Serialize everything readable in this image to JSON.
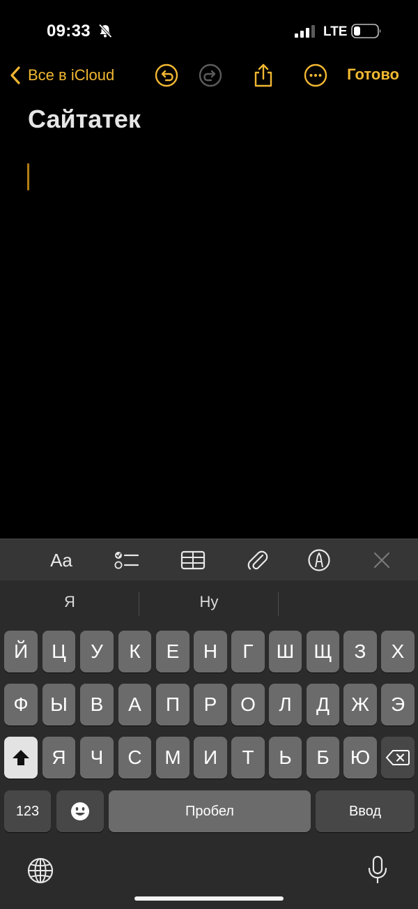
{
  "status_bar": {
    "time": "09:33",
    "network": "LTE"
  },
  "nav": {
    "back_label": "Все в iCloud",
    "done_label": "Готово"
  },
  "note": {
    "title": "Сайтатек"
  },
  "format_toolbar": {
    "text_style_label": "Aa"
  },
  "suggestions": [
    "Я",
    "Ну",
    ""
  ],
  "keyboard": {
    "row1": [
      "Й",
      "Ц",
      "У",
      "К",
      "Е",
      "Н",
      "Г",
      "Ш",
      "Щ",
      "З",
      "Х"
    ],
    "row2": [
      "Ф",
      "Ы",
      "В",
      "А",
      "П",
      "Р",
      "О",
      "Л",
      "Д",
      "Ж",
      "Э"
    ],
    "row3": [
      "Я",
      "Ч",
      "С",
      "М",
      "И",
      "Т",
      "Ь",
      "Б",
      "Ю"
    ],
    "numbers_label": "123",
    "space_label": "Пробел",
    "return_label": "Ввод"
  },
  "colors": {
    "accent": "#f2b833",
    "background": "#000000",
    "keyboard_bg": "#2b2b2b",
    "key_bg": "#6b6b6b"
  },
  "icons": {
    "status": [
      "bell-slash-icon",
      "cellular-signal-icon",
      "battery-icon"
    ],
    "nav": [
      "chevron-left-icon",
      "undo-icon",
      "redo-icon",
      "share-icon",
      "more-icon"
    ],
    "toolbar": [
      "checklist-icon",
      "table-icon",
      "paperclip-icon",
      "markup-pen-icon",
      "close-icon"
    ],
    "keyboard": [
      "shift-icon",
      "delete-icon",
      "emoji-icon",
      "globe-icon",
      "microphone-icon"
    ]
  }
}
